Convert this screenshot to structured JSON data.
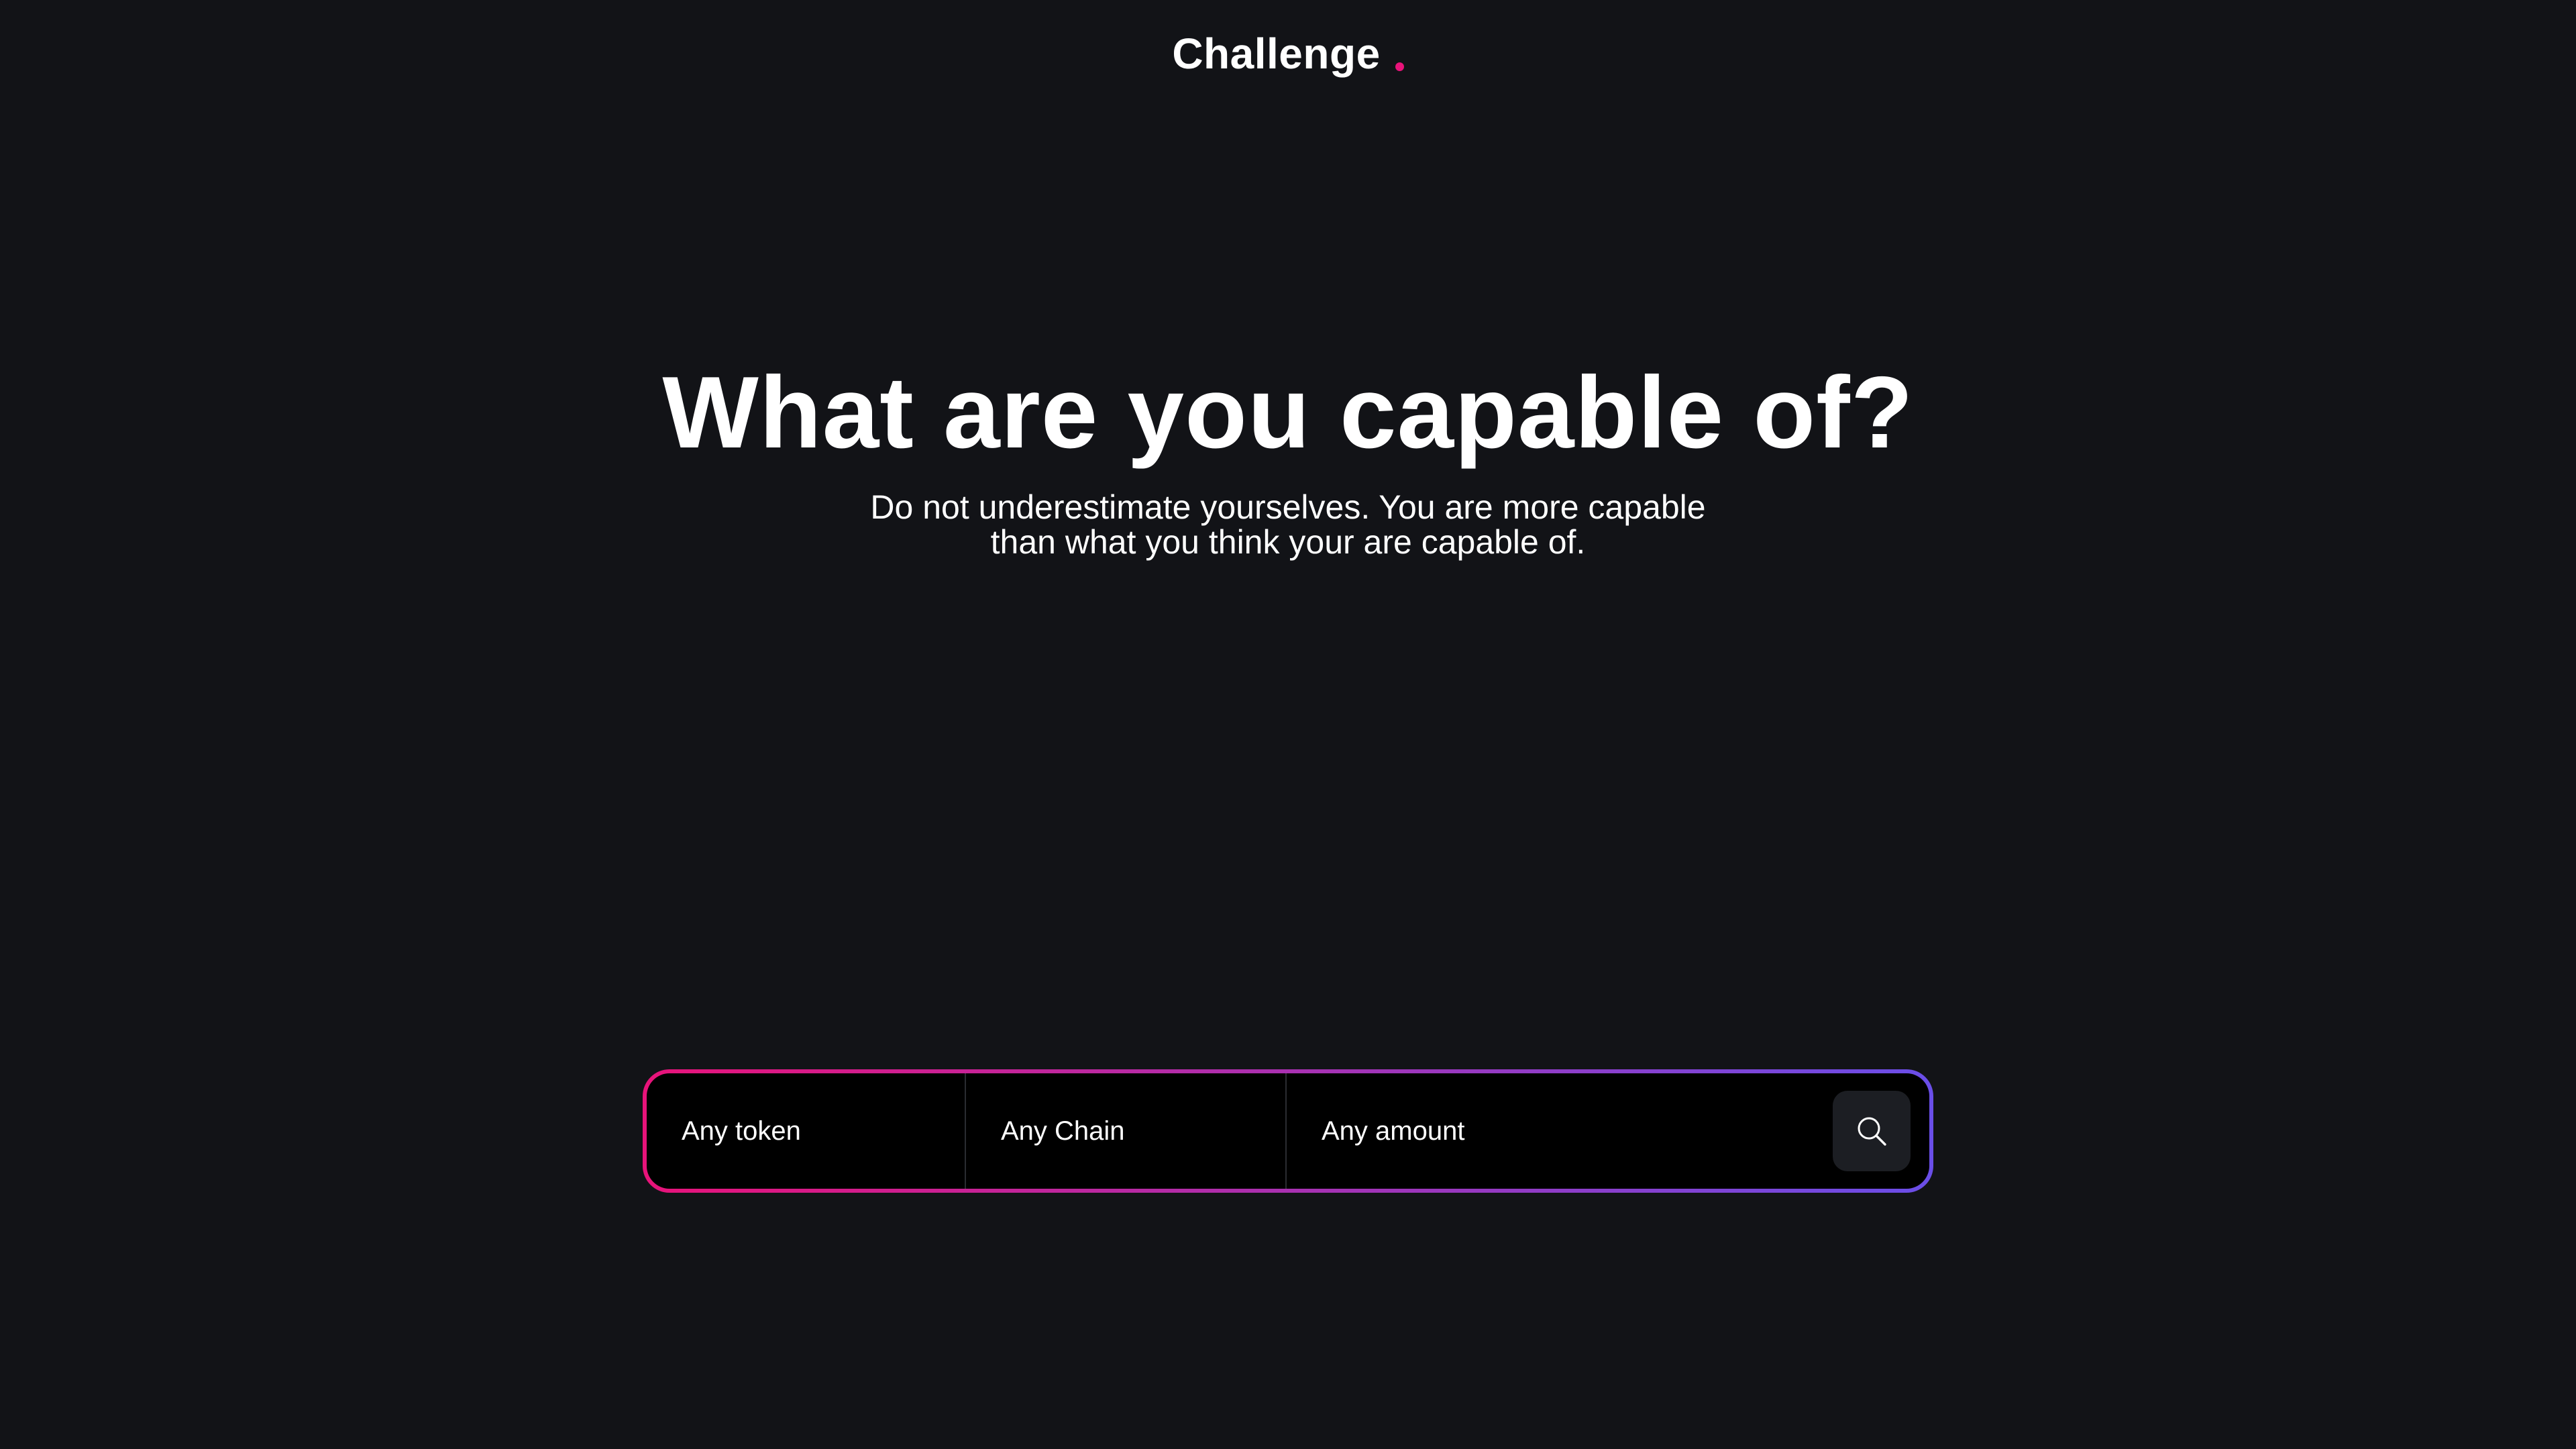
{
  "header": {
    "logo_text": "Challenge"
  },
  "hero": {
    "title": "What are you capable of?",
    "subtitle_line1": "Do not underestimate yourselves. You are more capable",
    "subtitle_line2": "than what you think your are capable of."
  },
  "search": {
    "token_label": "Any token",
    "chain_label": "Any Chain",
    "amount_placeholder": "Any amount",
    "button_icon": "search-icon"
  },
  "colors": {
    "background": "#121317",
    "accent_pink": "#e8137a",
    "accent_purple": "#6a4ee8",
    "text": "#ffffff"
  }
}
